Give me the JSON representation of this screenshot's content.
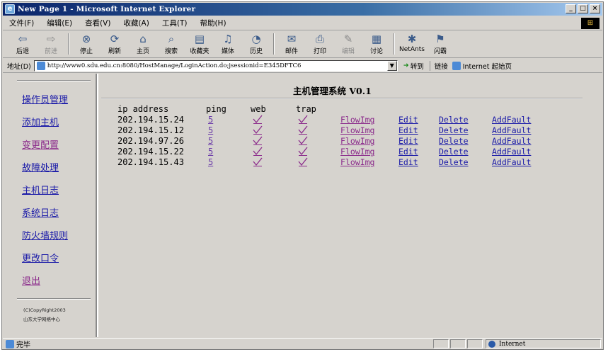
{
  "window": {
    "title": "New Page 1 - Microsoft Internet Explorer",
    "controls": {
      "minimize": "_",
      "maximize": "□",
      "close": "×"
    }
  },
  "menubar": {
    "items": [
      "文件(F)",
      "编辑(E)",
      "查看(V)",
      "收藏(A)",
      "工具(T)",
      "帮助(H)"
    ]
  },
  "toolbar": {
    "items": [
      {
        "label": "后退",
        "icon": "back-arrow-icon",
        "glyph": "⇦"
      },
      {
        "label": "前进",
        "icon": "forward-arrow-icon",
        "glyph": "⇨",
        "disabled": true
      },
      {
        "label": "停止",
        "icon": "stop-icon",
        "glyph": "⊗"
      },
      {
        "label": "刷新",
        "icon": "refresh-icon",
        "glyph": "⟳"
      },
      {
        "label": "主页",
        "icon": "home-icon",
        "glyph": "⌂"
      },
      {
        "label": "搜索",
        "icon": "search-icon",
        "glyph": "⌕"
      },
      {
        "label": "收藏夹",
        "icon": "favorites-icon",
        "glyph": "▤"
      },
      {
        "label": "媒体",
        "icon": "media-icon",
        "glyph": "♫"
      },
      {
        "label": "历史",
        "icon": "history-icon",
        "glyph": "◔"
      },
      {
        "label": "邮件",
        "icon": "mail-icon",
        "glyph": "✉"
      },
      {
        "label": "打印",
        "icon": "print-icon",
        "glyph": "⎙"
      },
      {
        "label": "编辑",
        "icon": "edit-icon",
        "glyph": "✎",
        "disabled": true
      },
      {
        "label": "讨论",
        "icon": "discuss-icon",
        "glyph": "▦"
      },
      {
        "label": "NetAnts",
        "icon": "netants-icon",
        "glyph": "✱"
      },
      {
        "label": "闪霸",
        "icon": "flashget-icon",
        "glyph": "⚑"
      }
    ]
  },
  "addressbar": {
    "label": "地址(D)",
    "url": "http://www0.sdu.edu.cn:8080/HostManage/LoginAction.do;jsessionid=E345DFTC6",
    "go_label": "转到",
    "links_label": "链接",
    "links_item": "Internet 起始页"
  },
  "sidebar": {
    "items": [
      {
        "label": "操作员管理",
        "visited": false
      },
      {
        "label": "添加主机",
        "visited": false
      },
      {
        "label": "变更配置",
        "visited": true
      },
      {
        "label": "故障处理",
        "visited": false
      },
      {
        "label": "主机日志",
        "visited": false
      },
      {
        "label": "系统日志",
        "visited": false
      },
      {
        "label": "防火墙规则",
        "visited": false
      },
      {
        "label": "更改口令",
        "visited": false
      },
      {
        "label": "退出",
        "visited": true
      }
    ],
    "copyright_line1": "(C)CopyRight2003",
    "copyright_line2": "山东大学网络中心"
  },
  "main": {
    "title": "主机管理系统 V0.1",
    "headers": {
      "ip": "ip address",
      "ping": "ping",
      "web": "web",
      "trap": "trap"
    },
    "link_labels": {
      "flowimg": "FlowImg",
      "edit": "Edit",
      "delete": "Delete",
      "addfault": "AddFault"
    },
    "hosts": [
      {
        "ip": "202.194.15.24",
        "ping": "5",
        "web": true,
        "trap": true
      },
      {
        "ip": "202.194.15.12",
        "ping": "5",
        "web": true,
        "trap": true
      },
      {
        "ip": "202.194.97.26",
        "ping": "5",
        "web": true,
        "trap": true
      },
      {
        "ip": "202.194.15.22",
        "ping": "5",
        "web": true,
        "trap": true
      },
      {
        "ip": "202.194.15.43",
        "ping": "5",
        "web": true,
        "trap": true
      }
    ]
  },
  "statusbar": {
    "status": "完毕",
    "zone": "Internet"
  },
  "colors": {
    "link": "#1a1aa8",
    "visited_link": "#8b2a8b",
    "check": "#8b2a8b",
    "chrome": "#d6d3ce"
  }
}
